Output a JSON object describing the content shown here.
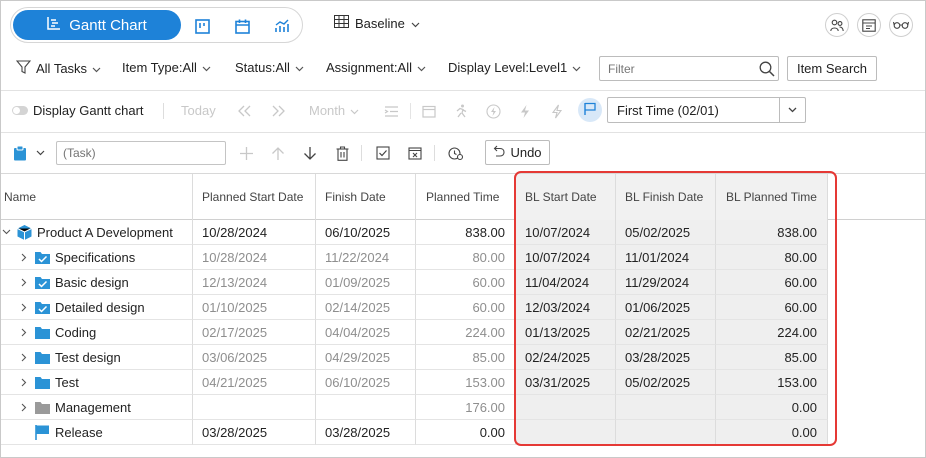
{
  "header": {
    "view_gantt_label": "Gantt Chart",
    "baseline_label": "Baseline"
  },
  "filters": {
    "all_tasks": "All Tasks",
    "item_type": "Item Type:All",
    "status": "Status:All",
    "assignment": "Assignment:All",
    "display_level": "Display Level:Level1",
    "filter_placeholder": "Filter",
    "item_search_label": "Item Search"
  },
  "toolbar": {
    "display_gantt_label": "Display Gantt chart",
    "today_label": "Today",
    "month_label": "Month",
    "baseline_select_value": "First Time (02/01)"
  },
  "edit_bar": {
    "task_placeholder": "(Task)",
    "undo_label": "Undo"
  },
  "table": {
    "columns": [
      "Name",
      "Planned Start Date",
      "Finish Date",
      "Planned Time",
      "BL Start Date",
      "BL Finish Date",
      "BL Planned Time"
    ],
    "rows": [
      {
        "name": "Product A Development",
        "start": "10/28/2024",
        "finish": "06/10/2025",
        "time": "838.00",
        "bl_start": "10/07/2024",
        "bl_finish": "05/02/2025",
        "bl_time": "838.00"
      },
      {
        "name": "Specifications",
        "start": "10/28/2024",
        "finish": "11/22/2024",
        "time": "80.00",
        "bl_start": "10/07/2024",
        "bl_finish": "11/01/2024",
        "bl_time": "80.00"
      },
      {
        "name": "Basic design",
        "start": "12/13/2024",
        "finish": "01/09/2025",
        "time": "60.00",
        "bl_start": "11/04/2024",
        "bl_finish": "11/29/2024",
        "bl_time": "60.00"
      },
      {
        "name": "Detailed design",
        "start": "01/10/2025",
        "finish": "02/14/2025",
        "time": "60.00",
        "bl_start": "12/03/2024",
        "bl_finish": "01/06/2025",
        "bl_time": "60.00"
      },
      {
        "name": "Coding",
        "start": "02/17/2025",
        "finish": "04/04/2025",
        "time": "224.00",
        "bl_start": "01/13/2025",
        "bl_finish": "02/21/2025",
        "bl_time": "224.00"
      },
      {
        "name": "Test design",
        "start": "03/06/2025",
        "finish": "04/29/2025",
        "time": "85.00",
        "bl_start": "02/24/2025",
        "bl_finish": "03/28/2025",
        "bl_time": "85.00"
      },
      {
        "name": "Test",
        "start": "04/21/2025",
        "finish": "06/10/2025",
        "time": "153.00",
        "bl_start": "03/31/2025",
        "bl_finish": "05/02/2025",
        "bl_time": "153.00"
      },
      {
        "name": "Management",
        "start": "",
        "finish": "",
        "time": "176.00",
        "bl_start": "",
        "bl_finish": "",
        "bl_time": "0.00"
      },
      {
        "name": "Release",
        "start": "03/28/2025",
        "finish": "03/28/2025",
        "time": "0.00",
        "bl_start": "",
        "bl_finish": "",
        "bl_time": "0.00"
      }
    ]
  },
  "colors": {
    "accent": "#1e82d8",
    "highlight": "#e53935",
    "folder": "#2b93d6",
    "folder_gray": "#9a9a9a",
    "project": "#2b93d6"
  }
}
